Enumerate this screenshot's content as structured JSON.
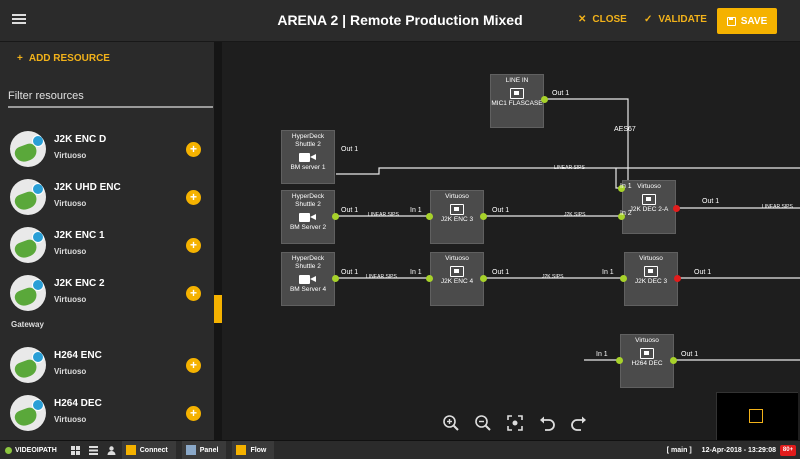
{
  "header": {
    "title": "ARENA 2 | Remote Production Mixed",
    "close_label": "CLOSE",
    "validate_label": "VALIDATE",
    "save_label": "SAVE"
  },
  "sidebar": {
    "add_label": "ADD RESOURCE",
    "filter_placeholder": "Filter resources",
    "group_label": "Gateway",
    "items": [
      {
        "name": "J2K ENC D",
        "sub": "Virtuoso",
        "badge_color": "#2a9fd6"
      },
      {
        "name": "J2K UHD ENC",
        "sub": "Virtuoso",
        "badge_color": "#2a9fd6"
      },
      {
        "name": "J2K ENC 1",
        "sub": "Virtuoso",
        "badge_color": "#2a9fd6"
      },
      {
        "name": "J2K ENC 2",
        "sub": "Virtuoso",
        "badge_color": "#2a9fd6"
      },
      {
        "name": "H264 ENC",
        "sub": "Virtuoso",
        "badge_color": "#2a9fd6"
      },
      {
        "name": "H264 DEC",
        "sub": "Virtuoso",
        "badge_color": "#2a9fd6"
      }
    ]
  },
  "canvas": {
    "nodes": {
      "line_in": {
        "top": "LINE IN",
        "bottom": "MIC1 FLASCASE"
      },
      "hyperdeck1": {
        "top": "HyperDeck Shuttle 2",
        "bottom": "BM server 1"
      },
      "hyperdeck2": {
        "top": "HyperDeck Shuttle 2",
        "bottom": "BM Server 2"
      },
      "hyperdeck4": {
        "top": "HyperDeck Shuttle 2",
        "bottom": "BM Server 4"
      },
      "enc3": {
        "top": "Virtuoso",
        "bottom": "J2K ENC 3"
      },
      "enc4": {
        "top": "Virtuoso",
        "bottom": "J2K ENC 4"
      },
      "dec2a": {
        "top": "Virtuoso",
        "bottom": "J2K DEC 2-A"
      },
      "dec3": {
        "top": "Virtuoso",
        "bottom": "J2K DEC 3"
      },
      "h264dec": {
        "top": "Virtuoso",
        "bottom": "H264 DEC"
      }
    },
    "labels": {
      "out1": "Out 1",
      "in1": "In 1",
      "in2": "In 2",
      "linear": "LINEAR SIPS",
      "j2k": "J2K SIPS",
      "aes": "AES67"
    }
  },
  "footer": {
    "brand": "VIDEOIPATH",
    "tab_connect": "Connect",
    "tab_panel": "Panel",
    "tab_flow": "Flow",
    "context": "[ main ]",
    "datetime": "12-Apr-2018 - 13:29:08",
    "badge": "80+"
  },
  "colors": {
    "accent": "#f5b200",
    "port_ok": "#a7d22a",
    "port_error": "#e21c1c"
  }
}
